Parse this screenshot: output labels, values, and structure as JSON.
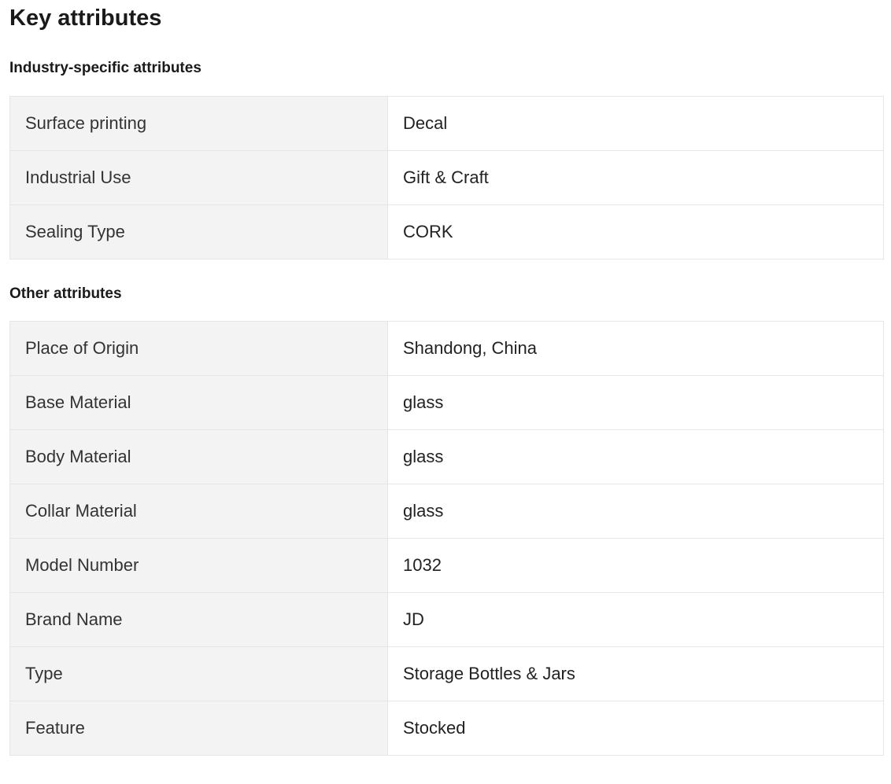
{
  "section": {
    "title": "Key attributes"
  },
  "industry": {
    "heading": "Industry-specific attributes",
    "rows": [
      {
        "key": "Surface printing",
        "value": "Decal"
      },
      {
        "key": "Industrial Use",
        "value": "Gift & Craft"
      },
      {
        "key": "Sealing Type",
        "value": "CORK"
      }
    ]
  },
  "other": {
    "heading": "Other attributes",
    "rows": [
      {
        "key": "Place of Origin",
        "value": "Shandong, China"
      },
      {
        "key": "Base Material",
        "value": "glass"
      },
      {
        "key": "Body Material",
        "value": "glass"
      },
      {
        "key": "Collar Material",
        "value": "glass"
      },
      {
        "key": "Model Number",
        "value": "1032"
      },
      {
        "key": "Brand Name",
        "value": "JD"
      },
      {
        "key": "Type",
        "value": "Storage Bottles & Jars"
      },
      {
        "key": "Feature",
        "value": "Stocked"
      }
    ]
  },
  "colors": {
    "key_cell_bg": "#f3f3f3",
    "border": "#e6e6e6",
    "text": "#222222"
  }
}
